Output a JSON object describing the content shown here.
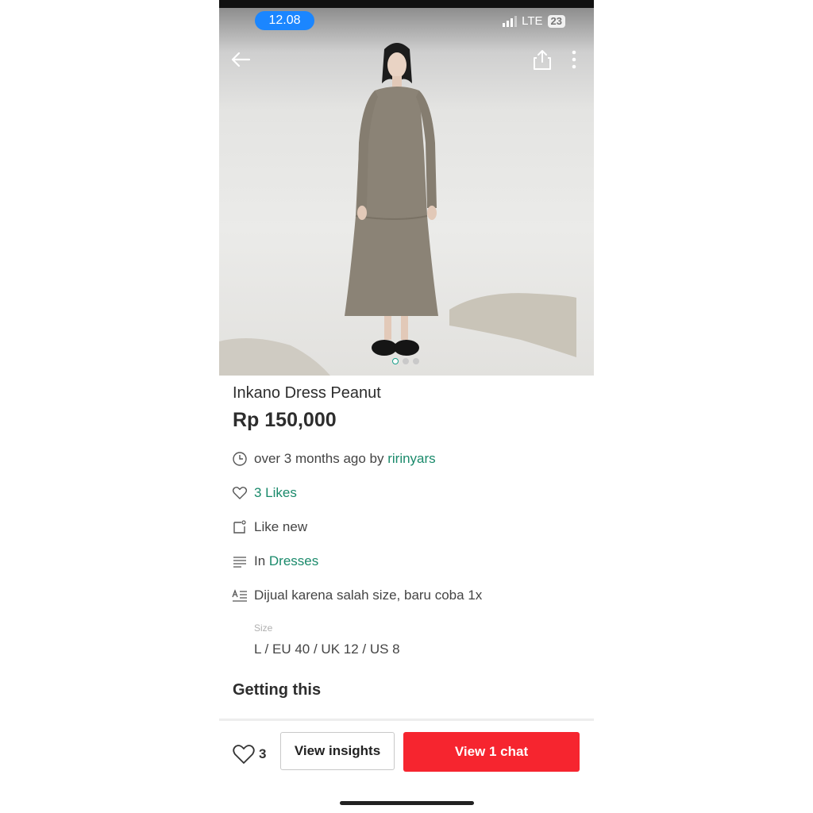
{
  "status": {
    "time": "12.08",
    "network": "LTE",
    "battery": "23"
  },
  "nav": {
    "back_icon": "arrow-left-icon",
    "share_icon": "share-icon",
    "more_icon": "more-vertical-icon"
  },
  "gallery": {
    "image_count": 3,
    "active_index": 0
  },
  "product": {
    "title": "Inkano Dress Peanut",
    "price": "Rp 150,000",
    "posted_text": "over 3 months ago by ",
    "seller": "ririnyars",
    "likes_text": "3 Likes",
    "condition": "Like new",
    "category_prefix": "In ",
    "category": "Dresses",
    "description": "Dijual karena salah size, baru coba 1x",
    "size_label": "Size",
    "size_value": "L / EU 40 / UK 12 / US 8"
  },
  "section": {
    "getting_this": "Getting this"
  },
  "bottom": {
    "like_count": "3",
    "insights_label": "View insights",
    "chat_label": "View 1 chat"
  },
  "colors": {
    "accent": "#1a8a6b",
    "chat_button": "#f6252f",
    "time_pill": "#1b86ff"
  }
}
